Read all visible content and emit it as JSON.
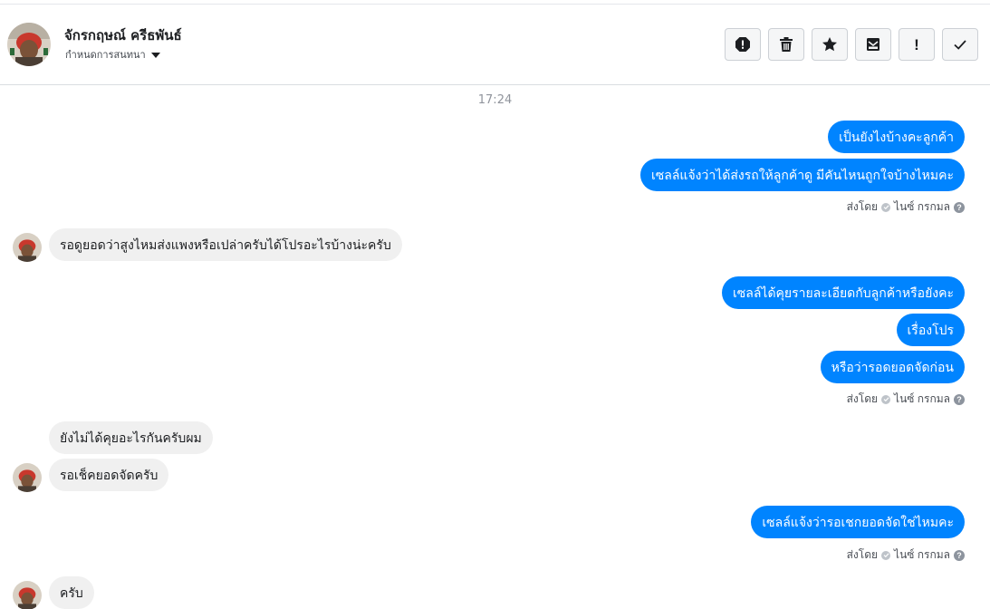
{
  "header": {
    "contact_name": "จักรกฤษณ์ ครีธพันธ์",
    "subtitle": "กำหนดการสนทนา",
    "actions": [
      {
        "name": "report-icon",
        "label": ""
      },
      {
        "name": "trash-icon",
        "label": ""
      },
      {
        "name": "star-icon",
        "label": ""
      },
      {
        "name": "mark-unread-icon",
        "label": ""
      },
      {
        "name": "important-icon",
        "label": "!"
      },
      {
        "name": "done-check-icon",
        "label": ""
      }
    ]
  },
  "thread": {
    "timestamp": "17:24",
    "messages": [
      {
        "dir": "out",
        "text": "เป็นยังไงบ้างคะลูกค้า"
      },
      {
        "dir": "out",
        "text": "เซลล์แจ้งว่าได้ส่งรถให้ลูกค้าดู  มีคันไหนถูกใจบ้างไหมคะ"
      },
      {
        "dir": "in",
        "text": "รอดูยอดว่าสูงไหมส่งแพงหรือเปล่าครับได้โปรอะไรบ้างน่ะครับ"
      },
      {
        "dir": "out",
        "text": "เซลล์ได้คุยรายละเอียดกับลูกค้าหรือยังคะ"
      },
      {
        "dir": "out",
        "text": "เรื่องโปร"
      },
      {
        "dir": "out",
        "text": "หรือว่ารอดยอดจัดก่อน"
      },
      {
        "dir": "in",
        "text": "ยังไม่ได้คุยอะไรกันครับผม"
      },
      {
        "dir": "in",
        "text": "รอเช็คยอดจัดครับ"
      },
      {
        "dir": "out",
        "text": "เซลล์แจ้งว่ารอเชกยอดจัดใช่ไหมคะ"
      },
      {
        "dir": "in",
        "text": "ครับ"
      }
    ],
    "sent_by_prefix": "ส่งโดย",
    "sent_by_name": "ไนซ์ กรกมล"
  },
  "colors": {
    "outgoing_bubble": "#0084ff",
    "incoming_bubble": "#f0f0f0"
  }
}
